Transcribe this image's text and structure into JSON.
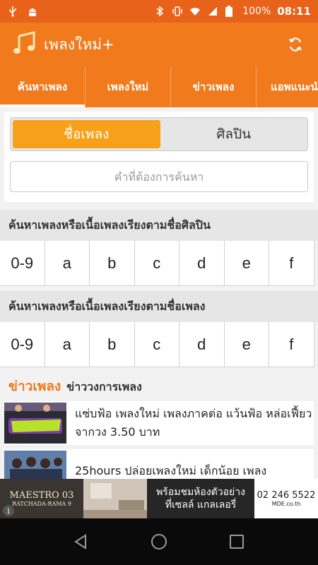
{
  "status_bar": {
    "battery": "100%",
    "time": "08:11"
  },
  "app_bar": {
    "title": "เพลงใหม่+",
    "accent": "#f07a1c"
  },
  "tabs": [
    {
      "label": "ค้นหาเพลง",
      "active": true
    },
    {
      "label": "เพลงใหม่"
    },
    {
      "label": "ข่าวเพลง"
    },
    {
      "label": "แอพแนะนำ"
    }
  ],
  "search": {
    "segments": [
      {
        "label": "ชื่อเพลง",
        "active": true
      },
      {
        "label": "ศิลปิน"
      }
    ],
    "placeholder": "คำที่ต้องการค้นหา"
  },
  "artist_section": {
    "title": "ค้นหาเพลงหรือเนื้อเพลงเรียงตามชื่อศิลปิน",
    "letters": [
      "0-9",
      "a",
      "b",
      "c",
      "d",
      "e",
      "f"
    ]
  },
  "song_section": {
    "title": "ค้นหาเพลงหรือเนื้อเพลงเรียงตามชื่อเพลง",
    "letters": [
      "0-9",
      "a",
      "b",
      "c",
      "d",
      "e",
      "f"
    ]
  },
  "news": {
    "title": "ข่าวเพลง",
    "subtitle": "ข่าววงการเพลง",
    "items": [
      {
        "text": "แซ่บฟ้อ เพลงใหม่ เพลงภาคต่อ แว้นฟ้อ หล่อเฟี้ยว จากวง 3.50 บาท"
      },
      {
        "text": "25hours ปล่อยเพลงใหม่ เด็กน้อย เพลง"
      }
    ]
  },
  "ad": {
    "brand": "MAESTRO 03",
    "brand_sub": "RATCHADA-RAMA 9",
    "headline_1": "พร้อมชมห้องตัวอย่าง",
    "headline_2": "ที่เซลล์ แกลเลอรี่",
    "phone": "02 246 5522",
    "site": "MDE.co.th"
  }
}
